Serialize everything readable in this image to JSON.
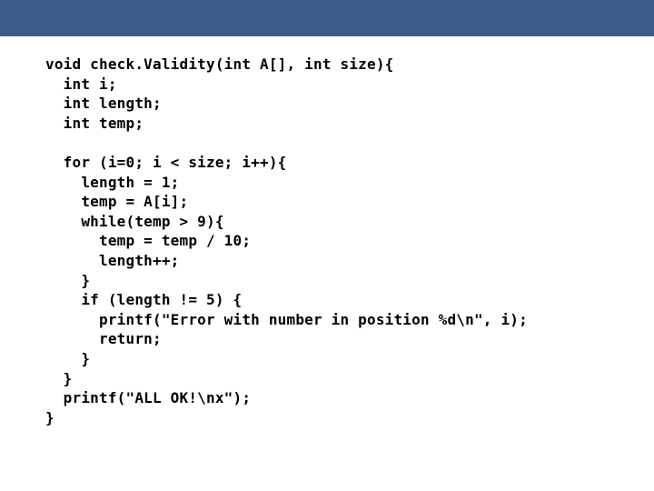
{
  "code": {
    "lines": [
      "void check.Validity(int A[], int size){",
      "  int i;",
      "  int length;",
      "  int temp;",
      "",
      "  for (i=0; i < size; i++){",
      "    length = 1;",
      "    temp = A[i];",
      "    while(temp > 9){",
      "      temp = temp / 10;",
      "      length++;",
      "    }",
      "    if (length != 5) {",
      "      printf(\"Error with number in position %d\\n\", i);",
      "      return;",
      "    }",
      "  }",
      "  printf(\"ALL OK!\\nx\");",
      "}"
    ]
  },
  "colors": {
    "header": "#3c5a8a"
  }
}
